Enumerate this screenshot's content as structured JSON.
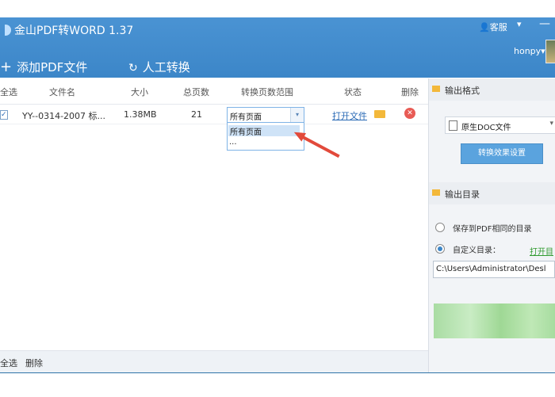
{
  "app": {
    "title": "金山PDF转WORD 1.37"
  },
  "titlebar": {
    "user_btn": "客服",
    "chevron": "▾",
    "minimize": "—",
    "username": "honpy"
  },
  "toolbar": {
    "add_pdf": "添加PDF文件",
    "manual_convert": "人工转换"
  },
  "table": {
    "headers": [
      "全选",
      "文件名",
      "大小",
      "总页数",
      "转换页数范围",
      "状态",
      "删除"
    ],
    "rows": [
      {
        "checked": "✓",
        "filename": "YY--0314-2007 标...",
        "size": "1.38MB",
        "pages": "21",
        "range": "所有页面",
        "status": "打开文件"
      }
    ]
  },
  "range_dropdown": {
    "selected": "所有页面",
    "options": [
      "所有页面",
      "..."
    ]
  },
  "bottom": {
    "select_all": "全选",
    "delete": "删除"
  },
  "output_format": {
    "section_title": "输出格式",
    "format_value": "原生DOC文件",
    "settings_button": "转换效果设置"
  },
  "output_dir": {
    "section_title": "输出目录",
    "option_same": "保存到PDF相同的目录",
    "option_custom": "自定义目录：",
    "open_dir": "打开目",
    "path": "C:\\Users\\Administrator\\Desl"
  },
  "colors": {
    "titlebar": "#3c86c8",
    "link": "#2a6ab5",
    "arrow": "#e24a3b",
    "folder": "#f3b83a"
  }
}
